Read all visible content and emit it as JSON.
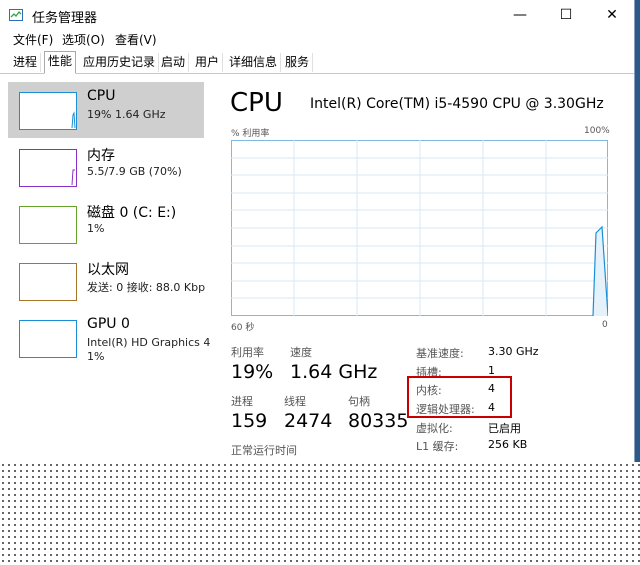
{
  "window": {
    "title": "任务管理器"
  },
  "controls": {
    "minimize": "—",
    "maximize": "☐",
    "close": "✕"
  },
  "menu": [
    "文件(F)",
    "选项(O)",
    "查看(V)"
  ],
  "tabs": [
    "进程",
    "性能",
    "应用历史记录",
    "启动",
    "用户",
    "详细信息",
    "服务"
  ],
  "active_tab": "性能",
  "sidebar": {
    "items": [
      {
        "title": "CPU",
        "sub": "19% 1.64 GHz",
        "color": "#1a8fd8"
      },
      {
        "title": "内存",
        "sub": "5.5/7.9 GB (70%)",
        "color": "#8b2fc9"
      },
      {
        "title": "磁盘 0 (C: E:)",
        "sub": "1%",
        "color": "#66a32b"
      },
      {
        "title": "以太网",
        "sub": "发送: 0 接收: 88.0 Kbp",
        "color": "#a8752b"
      },
      {
        "title": "GPU 0",
        "sub": "Intel(R) HD Graphics 4",
        "sub2": "1%",
        "color": "#1a8fd8"
      }
    ]
  },
  "main": {
    "title": "CPU",
    "model": "Intel(R) Core(TM) i5-4590 CPU @ 3.30GHz",
    "util_label": "% 利用率",
    "max_label": "100%",
    "time_label": "60 秒",
    "zero_label": "0",
    "stats": [
      {
        "label": "利用率",
        "value": "19%"
      },
      {
        "label": "速度",
        "value": "1.64 GHz"
      },
      {
        "label": "进程",
        "value": "159"
      },
      {
        "label": "线程",
        "value": "2474"
      },
      {
        "label": "句柄",
        "value": "80335"
      }
    ],
    "uptime_label": "正常运行时间",
    "specs": [
      {
        "label": "基准速度:",
        "value": "3.30 GHz"
      },
      {
        "label": "插槽:",
        "value": "1"
      },
      {
        "label": "内核:",
        "value": "4"
      },
      {
        "label": "逻辑处理器:",
        "value": "4"
      },
      {
        "label": "虚拟化:",
        "value": "已启用"
      },
      {
        "label": "L1 缓存:",
        "value": "256 KB"
      }
    ],
    "graph_color": "#1a8fd8"
  }
}
